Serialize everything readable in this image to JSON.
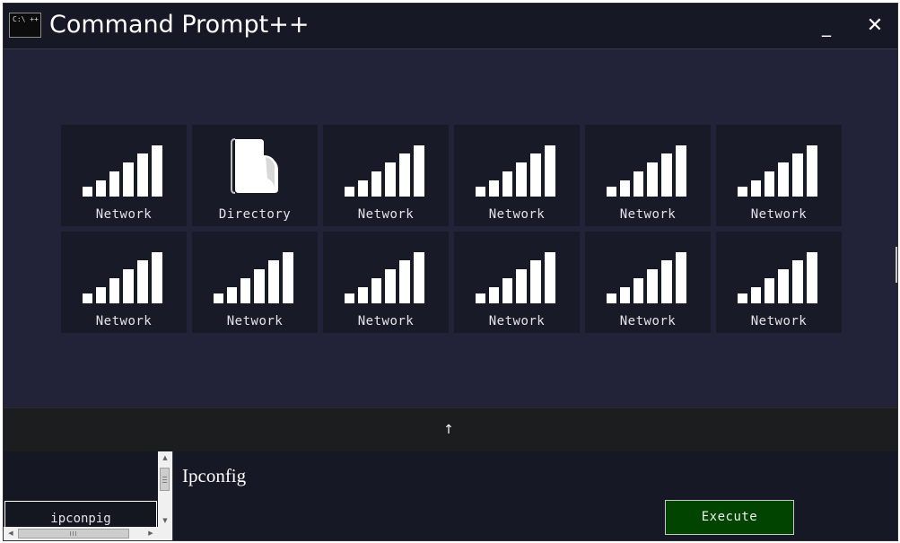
{
  "window": {
    "title": "Command Prompt++",
    "app_icon_text": "C:\\ ++",
    "minimize_label": "_",
    "close_label": "✕"
  },
  "tiles": [
    {
      "label": "Network",
      "icon": "network-signal-icon"
    },
    {
      "label": "Directory",
      "icon": "folder-icon"
    },
    {
      "label": "Network",
      "icon": "network-signal-icon"
    },
    {
      "label": "Network",
      "icon": "network-signal-icon"
    },
    {
      "label": "Network",
      "icon": "network-signal-icon"
    },
    {
      "label": "Network",
      "icon": "network-signal-icon"
    },
    {
      "label": "Network",
      "icon": "network-signal-icon"
    },
    {
      "label": "Network",
      "icon": "network-signal-icon"
    },
    {
      "label": "Network",
      "icon": "network-signal-icon"
    },
    {
      "label": "Network",
      "icon": "network-signal-icon"
    },
    {
      "label": "Network",
      "icon": "network-signal-icon"
    },
    {
      "label": "Network",
      "icon": "network-signal-icon"
    }
  ],
  "nav": {
    "up_label": "↑"
  },
  "history": {
    "items": [
      "ipconpig"
    ]
  },
  "command": {
    "text": "Ipconfig",
    "execute_label": "Execute"
  },
  "colors": {
    "window_bg": "#222338",
    "tile_bg": "#181a28",
    "execute_bg": "#004400"
  }
}
